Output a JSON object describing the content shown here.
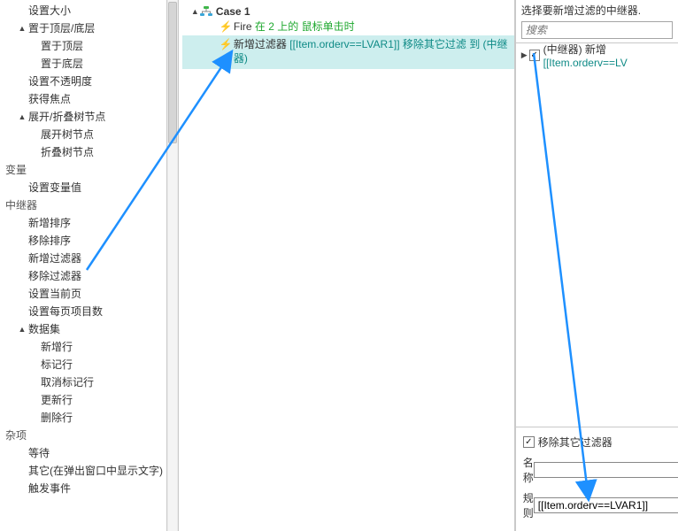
{
  "left_tree": {
    "topset": [
      {
        "label": "设置大小",
        "indent": 1,
        "caret": ""
      },
      {
        "label": "置于顶层/底层",
        "indent": 1,
        "caret": "▲"
      },
      {
        "label": "置于顶层",
        "indent": 2,
        "caret": ""
      },
      {
        "label": "置于底层",
        "indent": 2,
        "caret": ""
      },
      {
        "label": "设置不透明度",
        "indent": 1,
        "caret": ""
      },
      {
        "label": "获得焦点",
        "indent": 1,
        "caret": ""
      },
      {
        "label": "展开/折叠树节点",
        "indent": 1,
        "caret": "▲"
      },
      {
        "label": "展开树节点",
        "indent": 2,
        "caret": ""
      },
      {
        "label": "折叠树节点",
        "indent": 2,
        "caret": ""
      }
    ],
    "groups": [
      {
        "label": "变量",
        "items": [
          {
            "label": "设置变量值",
            "indent": 1
          }
        ]
      },
      {
        "label": "中继器",
        "items": [
          {
            "label": "新增排序",
            "indent": 1
          },
          {
            "label": "移除排序",
            "indent": 1
          },
          {
            "label": "新增过滤器",
            "indent": 1
          },
          {
            "label": "移除过滤器",
            "indent": 1
          },
          {
            "label": "设置当前页",
            "indent": 1
          },
          {
            "label": "设置每页项目数",
            "indent": 1
          }
        ]
      },
      {
        "label": "数据集",
        "caret": "▲",
        "items": [
          {
            "label": "新增行",
            "indent": 2
          },
          {
            "label": "标记行",
            "indent": 2
          },
          {
            "label": "取消标记行",
            "indent": 2
          },
          {
            "label": "更新行",
            "indent": 2
          },
          {
            "label": "删除行",
            "indent": 2
          }
        ]
      },
      {
        "label": "杂项",
        "items": [
          {
            "label": "等待",
            "indent": 1
          },
          {
            "label": "其它(在弹出窗口中显示文字)",
            "indent": 1
          },
          {
            "label": "触发事件",
            "indent": 1
          }
        ]
      }
    ]
  },
  "center": {
    "case_label": "Case 1",
    "event": {
      "name": "Fire",
      "suffix_green": "在 2 上的 鼠标单击时"
    },
    "action": {
      "name": "新增过滤器",
      "suffix_teal": "[[Item.orderv==LVAR1]] 移除其它过滤 到 (中继器)"
    }
  },
  "right": {
    "title": "选择要新增过滤的中继器.",
    "search_placeholder": "搜索",
    "item": {
      "label_plain": "(中继器) 新增",
      "label_teal": " [[Item.orderv==LV"
    },
    "remove_others_label": "移除其它过滤器",
    "name_label": "名称",
    "name_value": "",
    "rule_label": "规则",
    "rule_value": "[[Item.orderv==LVAR1]]"
  }
}
